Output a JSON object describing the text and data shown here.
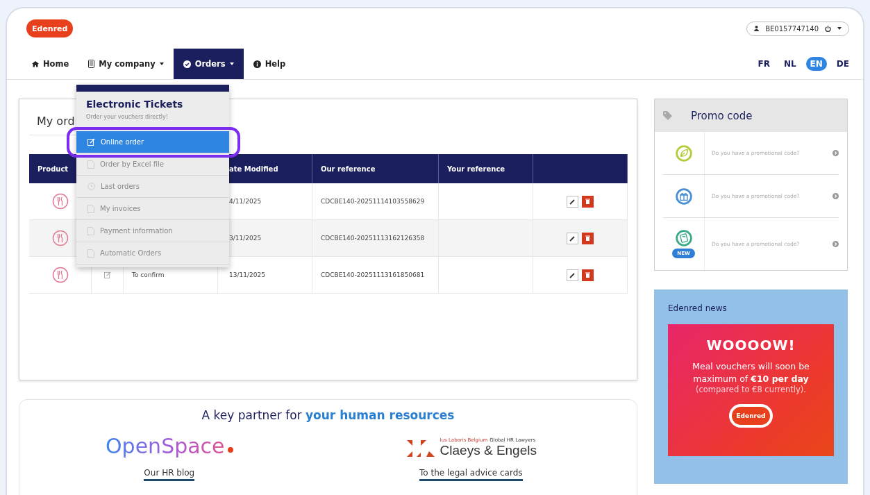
{
  "logo": "Edenred",
  "account": {
    "id": "BE0157747140"
  },
  "nav": [
    {
      "label": "Home",
      "dropdown": false,
      "selected": false
    },
    {
      "label": "My company",
      "dropdown": true,
      "selected": false
    },
    {
      "label": "Orders",
      "dropdown": true,
      "selected": true
    },
    {
      "label": "Help",
      "dropdown": false,
      "selected": false
    }
  ],
  "languages": [
    {
      "label": "FR",
      "selected": false
    },
    {
      "label": "NL",
      "selected": false
    },
    {
      "label": "EN",
      "selected": true
    },
    {
      "label": "DE",
      "selected": false
    }
  ],
  "orders_menu": {
    "title": "Electronic Tickets",
    "subtitle": "Order your vouchers directly!",
    "items": [
      {
        "label": "Online order",
        "selected": true,
        "annotated": true
      },
      {
        "label": "Order by Excel file",
        "selected": false,
        "annotated": false
      },
      {
        "label": "Last orders",
        "selected": false,
        "annotated": false
      },
      {
        "label": "My invoices",
        "selected": false,
        "annotated": false
      },
      {
        "label": "Payment information",
        "selected": false,
        "annotated": false
      },
      {
        "label": "Automatic Orders",
        "selected": false,
        "annotated": false
      }
    ]
  },
  "orders_card": {
    "title": "My ord",
    "columns": [
      "Product",
      "ate Modified",
      "Our reference",
      "Your reference"
    ],
    "rows": [
      {
        "date": "4/11/2025",
        "our_reference": "CDCBE140-20251114103558629"
      },
      {
        "date": "3/11/2025",
        "our_reference": "CDCBE140-20251113162126358"
      },
      {
        "status": "To confirm",
        "date": "13/11/2025",
        "our_reference": "CDCBE140-20251113161850681"
      }
    ]
  },
  "promo": {
    "title": "Promo code",
    "items": [
      {
        "color": "#b5cc3a",
        "text": "Do you have a promotional code?"
      },
      {
        "color": "#4a8fd6",
        "text": "Do you have a promotional code?"
      },
      {
        "color": "#3aa98a",
        "text": "Do you have a promotional code?",
        "badge": "NEW"
      }
    ]
  },
  "news": {
    "title": "Edenred news",
    "headline": "WOOOOW!",
    "body": "Meal vouchers will soon be maximum of **€10 per day**",
    "note": "(compared to €8 currently).",
    "logo": "Edenred"
  },
  "partners": {
    "title": "A key partner for **your human resources**",
    "items": [
      {
        "kind": "openspace",
        "logo": "OpenSpace",
        "link": "Our HR blog"
      },
      {
        "kind": "claeys",
        "tagline_red": "Ius Laboris Belgium",
        "tagline": "Global HR Lawyers",
        "logo": "Claeys & Engels",
        "link": "To the legal advice cards"
      }
    ]
  }
}
